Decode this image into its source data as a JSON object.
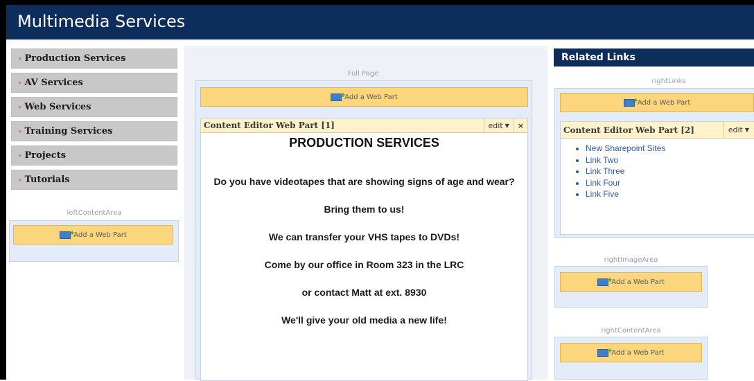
{
  "header": {
    "title": "Multimedia Services"
  },
  "leftnav": {
    "items": [
      {
        "label": "Production Services"
      },
      {
        "label": "AV Services"
      },
      {
        "label": "Web Services"
      },
      {
        "label": "Training Services"
      },
      {
        "label": "Projects"
      },
      {
        "label": "Tutorials"
      }
    ]
  },
  "zones": {
    "left_content": "leftContentArea",
    "full_page": "Full Page",
    "right_links": "rightLinks",
    "right_image": "rightImageArea",
    "right_content": "rightContentArea"
  },
  "add_web_part_label": "Add a Web Part",
  "center_webpart": {
    "title": "Content Editor Web Part [1]",
    "edit_label": "edit",
    "close_label": "×",
    "heading": "PRODUCTION SERVICES",
    "paragraphs": [
      "Do you have videotapes that are showing signs of age and wear?",
      "Bring them to us!",
      "We can transfer your VHS tapes to DVDs!",
      "Come by our office in Room 323 in the LRC",
      "or contact Matt at ext. 8930",
      "We'll give your old media a new life!"
    ]
  },
  "right": {
    "header": "Related Links",
    "webpart": {
      "title": "Content Editor Web Part [2]",
      "edit_label": "edit",
      "links": [
        "New Sharepoint Sites",
        "Link Two",
        "Link Three",
        "Link Four",
        "Link Five"
      ]
    }
  },
  "colors": {
    "header_bg": "#0d2e5c",
    "nav_bg": "#c8c8c8",
    "add_button_bg": "#fbd67c",
    "zone_bg": "#e3ecf8",
    "link": "#2a5aa6"
  },
  "icons": {
    "nav_bullet": "chevron-right-icon",
    "add_web_part": "add-web-part-icon",
    "edit_menu": "chevron-down-icon",
    "close": "close-icon"
  }
}
